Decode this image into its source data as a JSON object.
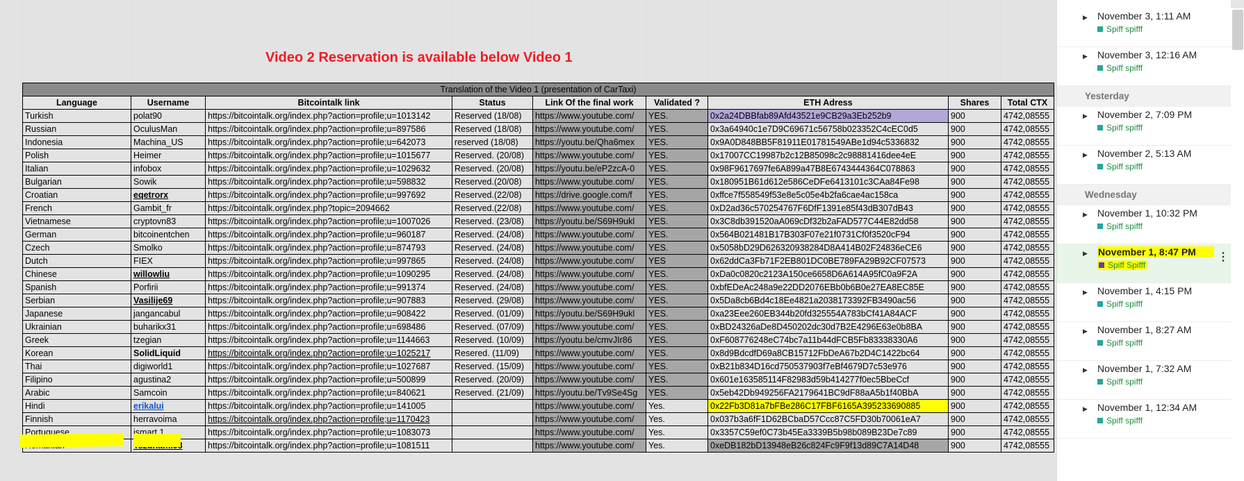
{
  "banner": "Video 2 Reservation is available below Video 1",
  "table_caption": "Translation of the Video 1 (presentation of CarTaxi)",
  "columns": [
    "Language",
    "Username",
    "Bitcointalk link",
    "Status",
    "Link Of the final work",
    "Validated ?",
    "ETH Adress",
    "Shares",
    "Total CTX"
  ],
  "rows": [
    {
      "language": "Turkish",
      "username": "polat90",
      "link": "https://bitcointalk.org/index.php?action=profile;u=1013142",
      "status": "Reserved (18/08)",
      "final": "https://www.youtube.com/",
      "validated": "YES.",
      "eth": "0x2a24DBBfab89Afd43521e9CB29a3Eb252b9",
      "shares": "900",
      "total": "4742,08555"
    },
    {
      "language": "Russian",
      "username": "OculusMan",
      "link": "https://bitcointalk.org/index.php?action=profile;u=897586",
      "status": "Reserved (18/08)",
      "final": "https://www.youtube.com/",
      "validated": "YES.",
      "eth": "0x3a64940c1e7D9C69671c56758b023352C4cEC0d5",
      "shares": "900",
      "total": "4742,08555"
    },
    {
      "language": "Indonesia",
      "username": "Machina_US",
      "link": "https://bitcointalk.org/index.php?action=profile;u=642073",
      "status": "reserved (18/08)",
      "final": "https://youtu.be/Qha6mex",
      "validated": "YES.",
      "eth": "0x9A0D848BB5F81911E01781549ABe1d94c5336832",
      "shares": "900",
      "total": "4742,08555"
    },
    {
      "language": "Polish",
      "username": "Heimer",
      "link": "https://bitcointalk.org/index.php?action=profile;u=1015677",
      "status": "Reserved. (20/08)",
      "final": "https://www.youtube.com/",
      "validated": "YES.",
      "eth": "0x17007CC19987b2c12B85098c2c98881416dee4eE",
      "shares": "900",
      "total": "4742,08555"
    },
    {
      "language": "Italian",
      "username": "infobox",
      "link": "https://bitcointalk.org/index.php?action=profile;u=1029632",
      "status": "Reserved. (20/08)",
      "final": "https://youtu.be/eP2zcA-0",
      "validated": "YES.",
      "eth": "0x98F9617697fe6A899a47B8E6743444364C078863",
      "shares": "900",
      "total": "4742,08555"
    },
    {
      "language": "Bulgarian",
      "username": "Sowik",
      "link": "https://bitcointalk.org/index.php?action=profile;u=598832",
      "status": "Reserved.(20/08)",
      "final": "https://www.youtube.com/",
      "validated": "YES.",
      "eth": "0x180951B61d612e586CeDFe6413101c3CAa84Fe98",
      "shares": "900",
      "total": "4742,08555"
    },
    {
      "language": "Croatian",
      "username": "eqetrorx",
      "link": "https://bitcointalk.org/index.php?action=profile;u=997692",
      "status": "Reserved.(22/08)",
      "final": "https://drive.google.com/f",
      "validated": "YES.",
      "eth": "0xffce7f558549f53e8e5c05e4b2fa6cae4ac158ca",
      "shares": "900",
      "total": "4742,08555"
    },
    {
      "language": "French",
      "username": "Gambit_fr",
      "link": "https://bitcointalk.org/index.php?topic=2094662",
      "status": "Reserved.(22/08)",
      "final": "https://www.youtube.com/",
      "validated": "YES.",
      "eth": "0xD2ad36c570254767F6DfF1391e85f43dB307dB43",
      "shares": "900",
      "total": "4742,08555"
    },
    {
      "language": "Vietnamese",
      "username": "cryptovn83",
      "link": "https://bitcointalk.org/index.php?action=profile;u=1007026",
      "status": "Reserved. (23/08)",
      "final": "https://youtu.be/S69H9ukl",
      "validated": "YES.",
      "eth": "0x3C8db391520aA069cDf32b2aFAD577C44E82dd58",
      "shares": "900",
      "total": "4742,08555"
    },
    {
      "language": "German",
      "username": "bitcoinentchen",
      "link": "https://bitcointalk.org/index.php?action=profile;u=960187",
      "status": "Reserved. (24/08)",
      "final": "https://www.youtube.com/",
      "validated": "YES.",
      "eth": "0x564B021481B17B303F07e21f0731Cf0f3520cF94",
      "shares": "900",
      "total": "4742,08555"
    },
    {
      "language": "Czech",
      "username": "Smolko",
      "link": "https://bitcointalk.org/index.php?action=profile;u=874793",
      "status": "Reserved. (24/08)",
      "final": "https://www.youtube.com/",
      "validated": "YES.",
      "eth": "0x5058bD29D626320938284D8A414B02F24836eCE6",
      "shares": "900",
      "total": "4742,08555"
    },
    {
      "language": "Dutch",
      "username": "FIEX",
      "link": "https://bitcointalk.org/index.php?action=profile;u=997865",
      "status": "Reserved. (24/08)",
      "final": "https://www.youtube.com/",
      "validated": "YES",
      "eth": "0x62ddCa3Fb71F2EB801DC0BE789FA29B92CF07573",
      "shares": "900",
      "total": "4742,08555"
    },
    {
      "language": "Chinese",
      "username": "willowliu",
      "link": "https://bitcointalk.org/index.php?action=profile;u=1090295",
      "status": "Reserved. (24/08)",
      "final": "https://www.youtube.com/",
      "validated": "YES.",
      "eth": "0xDa0c0820c2123A150ce6658D6A614A95fC0a9F2A",
      "shares": "900",
      "total": "4742,08555"
    },
    {
      "language": "Spanish",
      "username": "Porfirii",
      "link": "https://bitcointalk.org/index.php?action=profile;u=991374",
      "status": "Reserved. (24/08)",
      "final": "https://www.youtube.com/",
      "validated": "YES.",
      "eth": "0xbfEDeAc248a9e22DD2076EBb0b6B0e27EA8EC85E",
      "shares": "900",
      "total": "4742,08555"
    },
    {
      "language": "Serbian",
      "username": "Vasilije69",
      "link": "https://bitcointalk.org/index.php?action=profile;u=907883",
      "status": "Reserved. (29/08)",
      "final": "https://www.youtube.com/",
      "validated": "YES.",
      "eth": "0x5Da8cb6Bd4c18Ee4821a2038173392FB3490ac56",
      "shares": "900",
      "total": "4742,08555"
    },
    {
      "language": "Japanese",
      "username": "jangancabul",
      "link": "https://bitcointalk.org/index.php?action=profile;u=908422",
      "status": "Reserved. (01/09)",
      "final": "https://youtu.be/S69H9ukl",
      "validated": "YES.",
      "eth": "0xa23Eee260EB344b20fd325554A783bCf41A84ACF",
      "shares": "900",
      "total": "4742,08555"
    },
    {
      "language": "Ukrainian",
      "username": "buharikx31",
      "link": "https://bitcointalk.org/index.php?action=profile;u=698486",
      "status": "Reserved. (07/09)",
      "final": "https://www.youtube.com/",
      "validated": "YES.",
      "eth": "0xBD24326aDe8D450202dc30d7B2E4296E63e0b8BA",
      "shares": "900",
      "total": "4742,08555"
    },
    {
      "language": "Greek",
      "username": "tzegian",
      "link": "https://bitcointalk.org/index.php?action=profile;u=1144663",
      "status": "Reserved. (10/09)",
      "final": "https://youtu.be/cmvJIr86",
      "validated": "YES.",
      "eth": "0xF608776248eC74bc7a11b44dFCB5Fb83338330A6",
      "shares": "900",
      "total": "4742,08555"
    },
    {
      "language": "Korean",
      "username": "SolidLiquid",
      "link": "https://bitcointalk.org/index.php?action=profile;u=1025217",
      "status": "Resered. (11/09)",
      "final": "https://www.youtube.com/",
      "validated": "YES.",
      "eth": "0x8d9BdcdfD69a8CB15712FbDeA67b2D4C1422bc64",
      "shares": "900",
      "total": "4742,08555"
    },
    {
      "language": "Thai",
      "username": "digiworld1",
      "link": "https://bitcointalk.org/index.php?action=profile;u=1027687",
      "status": "Reserved. (15/09)",
      "final": "https://www.youtube.com/",
      "validated": "YES.",
      "eth": "0xB21b834D16cd750537903f7eBf4679D7c53e976",
      "shares": "900",
      "total": "4742,08555"
    },
    {
      "language": "Filipino",
      "username": "agustina2",
      "link": "https://bitcointalk.org/index.php?action=profile;u=500899",
      "status": "Reserved. (20/09)",
      "final": "https://www.youtube.com/",
      "validated": "YES.",
      "eth": "0x601e163585114F82983d59b414277f0ec5BbeCcf",
      "shares": "900",
      "total": "4742,08555"
    },
    {
      "language": "Arabic",
      "username": "Samcoin",
      "link": "https://bitcointalk.org/index.php?action=profile;u=840621",
      "status": "Reserved. (21/09)",
      "final": "https://youtu.be/Tv9Se4Sg",
      "validated": "YES.",
      "eth": "0x5eb42Db949256FA2179641BC9dF88aA5b1f40BbA",
      "shares": "900",
      "total": "4742,08555"
    },
    {
      "language": "Hindi",
      "username": "erikalui",
      "link": "https://bitcointalk.org/index.php?action=profile;u=141005",
      "status": "",
      "final": "https://www.youtube.com/",
      "validated": "Yes.",
      "eth": "0x22Fb3D81a7bFBe286C17FBF6165A395233690885",
      "shares": "900",
      "total": "4742,08555"
    },
    {
      "language": "Finnish",
      "username": "herravoima",
      "link": "https://bitcointalk.org/index.php?action=profile;u=1170423",
      "status": "",
      "final": "https://www.youtube.com/",
      "validated": "Yes.",
      "eth": "0x037b3a6fF1D62BCbaD57Ccc87C5FD30b70061eA7",
      "shares": "900",
      "total": "4742,08555"
    },
    {
      "language": "Portuguese",
      "username": "ismart 1",
      "link": "https://bitcointalk.org/index.php?action=profile;u=1083073",
      "status": "",
      "final": "https://www.youtube.com/",
      "validated": "Yes.",
      "eth": "0x3357C59ef0C73b45Ea3339B5b98b089B23De7c89",
      "shares": "900",
      "total": "4742,08555"
    },
    {
      "language": "Romanian",
      "username": "Tszunami98",
      "link": "https://bitcointalk.org/index.php?action=profile;u=1081511",
      "status": "",
      "final": "https://www.youtube.com/",
      "validated": "Yes.",
      "eth": "0xeDB182bD13948eB26c824Fc9F9f13d89C7A14D48",
      "shares": "900",
      "total": "4742,08555"
    }
  ],
  "history": {
    "groups": [
      {
        "label": "",
        "entries": [
          {
            "time": "November 3, 1:11 AM",
            "user": "Spiff spifff"
          },
          {
            "time": "November 3, 12:16 AM",
            "user": "Spiff spifff"
          }
        ]
      },
      {
        "label": "Yesterday",
        "entries": [
          {
            "time": "November 2, 7:09 PM",
            "user": "Spiff spifff"
          },
          {
            "time": "November 2, 5:13 AM",
            "user": "Spiff spifff"
          }
        ]
      },
      {
        "label": "Wednesday",
        "entries": [
          {
            "time": "November 1, 10:32 PM",
            "user": "Spiff spifff"
          },
          {
            "time": "November 1, 8:47 PM",
            "user": "Spiff Spifff",
            "selected": true
          },
          {
            "time": "November 1, 4:15 PM",
            "user": "Spiff spifff"
          },
          {
            "time": "November 1, 8:27 AM",
            "user": "Spiff spifff"
          },
          {
            "time": "November 1, 7:32 AM",
            "user": "Spiff spifff"
          },
          {
            "time": "November 1, 12:34 AM",
            "user": "Spiff spifff"
          }
        ]
      }
    ],
    "icons": {
      "expand": "triangle-right-icon",
      "more": "more-vert-icon"
    },
    "colors": {
      "user_square": "#26a69a",
      "selected_square": "#673ab7",
      "highlight": "#ffff00"
    }
  }
}
